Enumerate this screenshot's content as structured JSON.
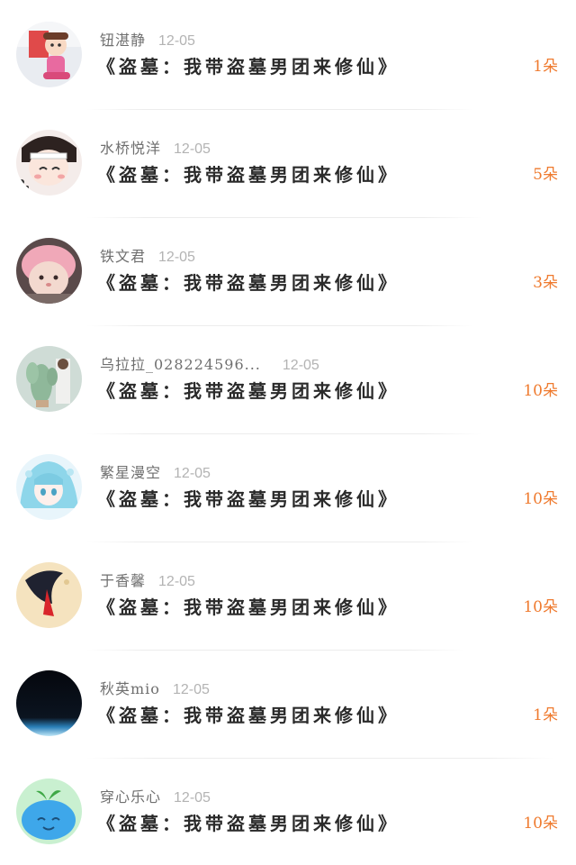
{
  "gifts": [
    {
      "user": "钮湛静",
      "date": "12-05",
      "book": "《盗墓：我带盗墓男团来修仙》",
      "amount": "1朵",
      "avatar_icon": "doll-avatar-icon"
    },
    {
      "user": "水桥悦洋",
      "date": "12-05",
      "book": "《盗墓：我带盗墓男团来修仙》",
      "amount": "5朵",
      "avatar_icon": "cartoon-girl-avatar-icon"
    },
    {
      "user": "铁文君",
      "date": "12-05",
      "book": "《盗墓：我带盗墓男团来修仙》",
      "amount": "3朵",
      "avatar_icon": "pink-cat-avatar-icon"
    },
    {
      "user": "乌拉拉_028224596...",
      "date": "12-05",
      "book": "《盗墓：我带盗墓男团来修仙》",
      "amount": "10朵",
      "avatar_icon": "cactus-avatar-icon"
    },
    {
      "user": "繁星漫空",
      "date": "12-05",
      "book": "《盗墓：我带盗墓男团来修仙》",
      "amount": "10朵",
      "avatar_icon": "anime-girl-avatar-icon"
    },
    {
      "user": "于香馨",
      "date": "12-05",
      "book": "《盗墓：我带盗墓男团来修仙》",
      "amount": "10朵",
      "avatar_icon": "moon-illustration-avatar-icon"
    },
    {
      "user": "秋英mio",
      "date": "12-05",
      "book": "《盗墓：我带盗墓男团来修仙》",
      "amount": "1朵",
      "avatar_icon": "night-sky-avatar-icon"
    },
    {
      "user": "穿心乐心",
      "date": "12-05",
      "book": "《盗墓：我带盗墓男团来修仙》",
      "amount": "10朵",
      "avatar_icon": "blue-blob-avatar-icon"
    }
  ],
  "colors": {
    "accent": "#ef7a2e",
    "name": "#6f6f6f",
    "date": "#b3b3b3",
    "title": "#2a2a2a"
  }
}
